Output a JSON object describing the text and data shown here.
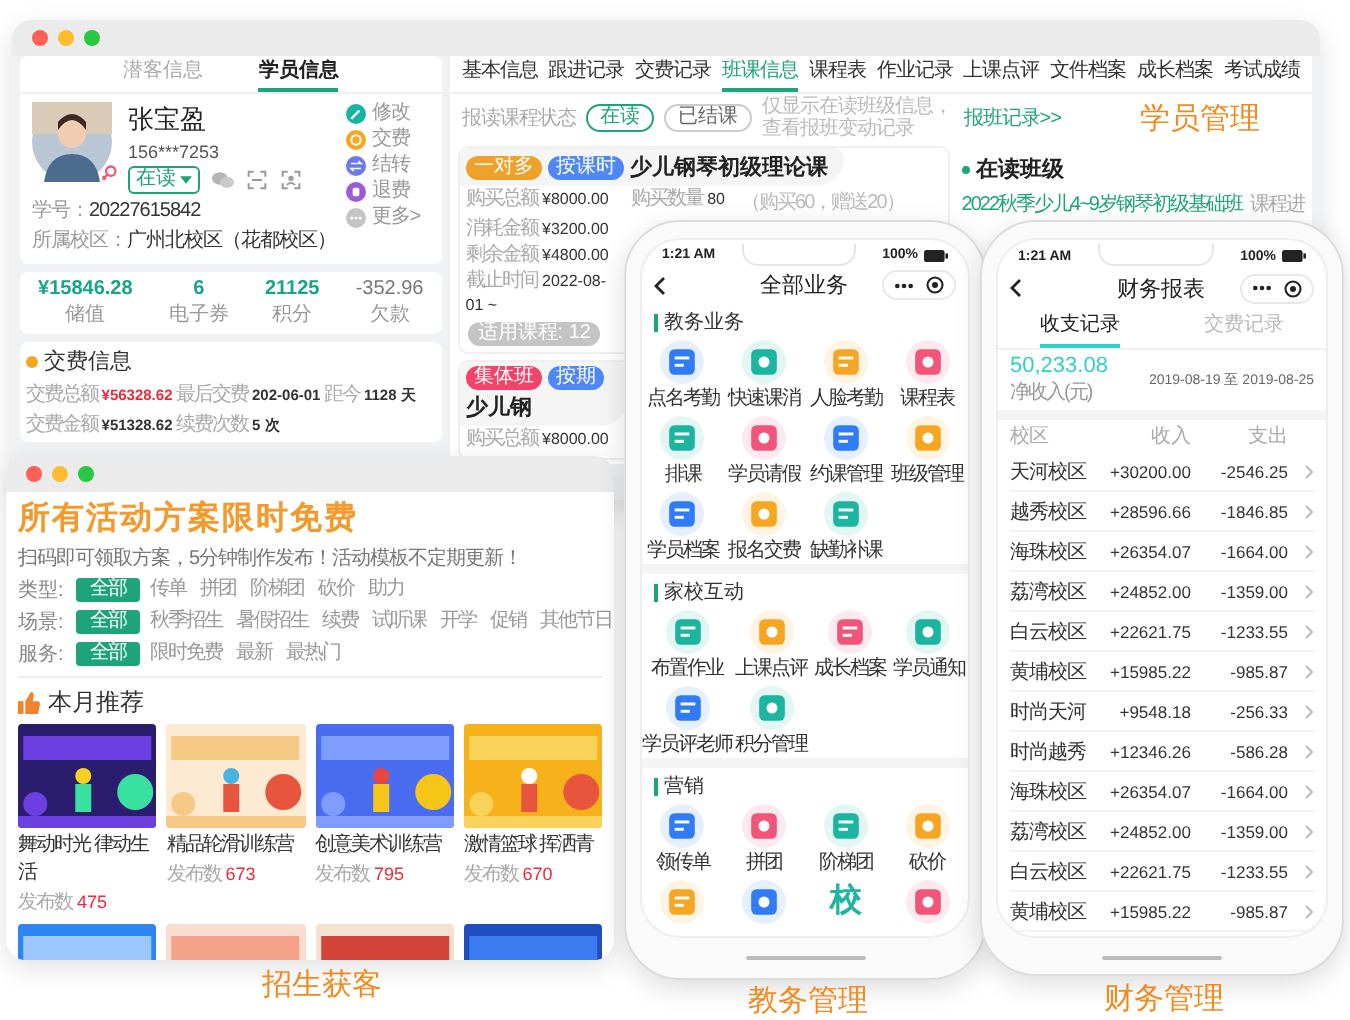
{
  "student_window": {
    "left_tabs": [
      {
        "label": "潜客信息",
        "selected": false
      },
      {
        "label": "学员信息",
        "selected": true
      }
    ],
    "profile": {
      "name": "张宝盈",
      "phone": "156***7253",
      "status": "在读",
      "fields": [
        {
          "label": "学号：",
          "value": "20227615842"
        },
        {
          "label": "所属校区：",
          "value": "广州北校区（花都校区）"
        }
      ]
    },
    "actions": [
      {
        "kind": "edit",
        "label": "修改",
        "color": "#17b3a3"
      },
      {
        "kind": "pay",
        "label": "交费",
        "color": "#f5a623"
      },
      {
        "kind": "transfer",
        "label": "结转",
        "color": "#6b78ee"
      },
      {
        "kind": "refund",
        "label": "退费",
        "color": "#9b5ad6"
      },
      {
        "kind": "more",
        "label": "更多>",
        "color": "#c4c4c4"
      }
    ],
    "stats": [
      {
        "value": "¥15846.28",
        "label": "储值",
        "negative": false
      },
      {
        "value": "6",
        "label": "电子券",
        "negative": false
      },
      {
        "value": "21125",
        "label": "积分",
        "negative": false
      },
      {
        "value": "-352.96",
        "label": "欠款",
        "negative": true
      }
    ],
    "fee_info": {
      "title": "交费信息",
      "items": [
        {
          "label": "交费总额",
          "value": "¥56328.62",
          "highlight": true
        },
        {
          "label": "最后交费",
          "value": "202-06-01",
          "highlight": false
        },
        {
          "label": "距今",
          "value": "1128 天",
          "highlight": false
        },
        {
          "label": "交费金额",
          "value": "¥51328.62",
          "highlight": false
        },
        {
          "label": "续费次数",
          "value": "5 次",
          "highlight": false
        }
      ]
    },
    "tabs": [
      {
        "label": "基本信息",
        "selected": false
      },
      {
        "label": "跟进记录",
        "selected": false
      },
      {
        "label": "交费记录",
        "selected": false
      },
      {
        "label": "班课信息",
        "selected": true
      },
      {
        "label": "课程表",
        "selected": false
      },
      {
        "label": "作业记录",
        "selected": false
      },
      {
        "label": "上课点评",
        "selected": false
      },
      {
        "label": "文件档案",
        "selected": false
      },
      {
        "label": "成长档案",
        "selected": false
      },
      {
        "label": "考试成绩",
        "selected": false
      }
    ],
    "course_status": {
      "label": "报读课程状态",
      "options": [
        {
          "label": "在读",
          "selected": true
        },
        {
          "label": "已结课",
          "selected": false
        }
      ],
      "note": "仅显示在读班级信息，查看报班变动记录",
      "link": "报班记录>>"
    },
    "caption": "学员管理",
    "courses": [
      {
        "badges": [
          {
            "label": "一对多",
            "color": "#f0a12a"
          },
          {
            "label": "按课时",
            "color": "#4f87f5"
          }
        ],
        "title": "少儿钢琴初级理论课",
        "fields": [
          {
            "label": "购买总额",
            "value": "¥8000.00"
          },
          {
            "label": "消耗金额",
            "value": "¥3200.00"
          },
          {
            "label": "剩余金额",
            "value": "¥4800.00"
          },
          {
            "label": "截止时间",
            "value": "2022-08-01 ~"
          }
        ],
        "extra": {
          "label": "购买数量",
          "value": "80",
          "note": "（购买60，赠送20）"
        },
        "chip": "适用课程: 12"
      },
      {
        "badges": [
          {
            "label": "集体班",
            "color": "#f2446b"
          },
          {
            "label": "按期",
            "color": "#4f87f5"
          }
        ],
        "title": "少儿钢",
        "fields": [
          {
            "label": "购买总额",
            "value": "¥8000.00"
          }
        ]
      }
    ],
    "active_classes": {
      "title": "在读班级",
      "items": [
        {
          "name": "2022秋季少儿4~9岁钢琴初级基础班",
          "tag": "课程进"
        }
      ]
    }
  },
  "campaign_window": {
    "headline": "所有活动方案限时免费",
    "subline": "扫码即可领取方案，5分钟制作发布！活动模板不定期更新！",
    "filters": [
      {
        "label": "类型:",
        "options": [
          {
            "label": "全部",
            "selected": true
          },
          {
            "label": "传单",
            "selected": false
          },
          {
            "label": "拼团",
            "selected": false
          },
          {
            "label": "阶梯团",
            "selected": false
          },
          {
            "label": "砍价",
            "selected": false
          },
          {
            "label": "助力",
            "selected": false
          }
        ]
      },
      {
        "label": "场景:",
        "options": [
          {
            "label": "全部",
            "selected": true
          },
          {
            "label": "秋季招生",
            "selected": false
          },
          {
            "label": "暑假招生",
            "selected": false
          },
          {
            "label": "续费",
            "selected": false
          },
          {
            "label": "试听课",
            "selected": false
          },
          {
            "label": "开学",
            "selected": false
          },
          {
            "label": "促销",
            "selected": false
          },
          {
            "label": "其他节日",
            "selected": false
          }
        ]
      },
      {
        "label": "服务:",
        "options": [
          {
            "label": "全部",
            "selected": true
          },
          {
            "label": "限时免费",
            "selected": false
          },
          {
            "label": "最新",
            "selected": false
          },
          {
            "label": "最热门",
            "selected": false
          }
        ]
      }
    ],
    "section_title": "本月推荐",
    "cards": [
      {
        "title": "舞动时光 律动生活",
        "count_label": "发布数",
        "count": "475"
      },
      {
        "title": "精品轮滑训练营",
        "count_label": "发布数",
        "count": "673"
      },
      {
        "title": "创意美术训练营",
        "count_label": "发布数",
        "count": "795"
      },
      {
        "title": "激情篮球 挥洒青",
        "count_label": "发布数",
        "count": "670"
      }
    ],
    "caption": "招生获客"
  },
  "business_phone": {
    "time": "1:21 AM",
    "battery": "100%",
    "title": "全部业务",
    "sections": [
      {
        "title": "教务业务",
        "items": [
          {
            "label": "点名考勤",
            "color": "#2f7cf6"
          },
          {
            "label": "快速课消",
            "color": "#1bb5a0"
          },
          {
            "label": "人脸考勤",
            "color": "#f5a623"
          },
          {
            "label": "课程表",
            "color": "#f2557a"
          },
          {
            "label": "排课",
            "color": "#1bb5a0"
          },
          {
            "label": "学员请假",
            "color": "#f2557a"
          },
          {
            "label": "约课管理",
            "color": "#2f7cf6"
          },
          {
            "label": "班级管理",
            "color": "#f5a623"
          },
          {
            "label": "学员档案",
            "color": "#2f7cf6"
          },
          {
            "label": "报名交费",
            "color": "#f5a623"
          },
          {
            "label": "缺勤补课",
            "color": "#1bb5a0"
          }
        ]
      },
      {
        "title": "家校互动",
        "items": [
          {
            "label": "布置作业",
            "color": "#1bb5a0"
          },
          {
            "label": "上课点评",
            "color": "#f5a623"
          },
          {
            "label": "成长档案",
            "color": "#f2557a"
          },
          {
            "label": "学员通知",
            "color": "#1bb5a0"
          },
          {
            "label": "学员评老师",
            "color": "#2f7cf6"
          },
          {
            "label": "积分管理",
            "color": "#1bb5a0"
          }
        ]
      },
      {
        "title": "营销",
        "items": [
          {
            "label": "领传单",
            "color": "#2f7cf6"
          },
          {
            "label": "拼团",
            "color": "#f2557a"
          },
          {
            "label": "阶梯团",
            "color": "#1bb5a0"
          },
          {
            "label": "砍价",
            "color": "#f5a623"
          },
          {
            "color": "#f5a623"
          },
          {
            "color": "#2f7cf6"
          },
          {
            "glyph": "校",
            "color": "#1bb5a0"
          },
          {
            "color": "#f2557a"
          }
        ]
      }
    ],
    "caption": "教务管理"
  },
  "finance_phone": {
    "time": "1:21 AM",
    "battery": "100%",
    "title": "财务报表",
    "tabs": [
      {
        "label": "收支记录",
        "selected": true
      },
      {
        "label": "交费记录",
        "selected": false
      }
    ],
    "net_income": "50,233.08",
    "net_income_label": "净收入(元)",
    "date_from": "2019-08-19",
    "date_sep": "至",
    "date_to": "2019-08-25",
    "columns": [
      "校区",
      "收入",
      "支出"
    ],
    "rows": [
      [
        "天河校区",
        "+30200.00",
        "-2546.25"
      ],
      [
        "越秀校区",
        "+28596.66",
        "-1846.85"
      ],
      [
        "海珠校区",
        "+26354.07",
        "-1664.00"
      ],
      [
        "荔湾校区",
        "+24852.00",
        "-1359.00"
      ],
      [
        "白云校区",
        "+22621.75",
        "-1233.55"
      ],
      [
        "黄埔校区",
        "+15985.22",
        "-985.87"
      ],
      [
        "时尚天河",
        "+9548.18",
        "-256.33"
      ],
      [
        "时尚越秀",
        "+12346.26",
        "-586.28"
      ],
      [
        "海珠校区",
        "+26354.07",
        "-1664.00"
      ],
      [
        "荔湾校区",
        "+24852.00",
        "-1359.00"
      ],
      [
        "白云校区",
        "+22621.75",
        "-1233.55"
      ],
      [
        "黄埔校区",
        "+15985.22",
        "-985.87"
      ]
    ],
    "caption": "财务管理"
  }
}
